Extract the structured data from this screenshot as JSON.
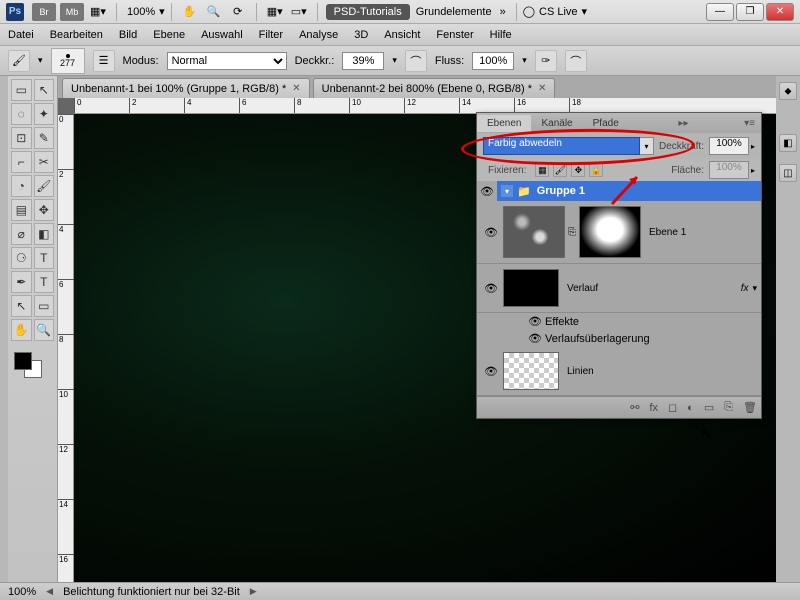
{
  "titlebar": {
    "ps": "Ps",
    "badges": [
      "Br",
      "Mb"
    ],
    "zoom": "100%",
    "tab1": "PSD-Tutorials",
    "tab2": "Grundelemente",
    "cslive": "CS Live"
  },
  "menu": [
    "Datei",
    "Bearbeiten",
    "Bild",
    "Ebene",
    "Auswahl",
    "Filter",
    "Analyse",
    "3D",
    "Ansicht",
    "Fenster",
    "Hilfe"
  ],
  "options": {
    "brush_size": "277",
    "modus_label": "Modus:",
    "modus_value": "Normal",
    "deckkr_label": "Deckkr.:",
    "deckkr_value": "39%",
    "fluss_label": "Fluss:",
    "fluss_value": "100%"
  },
  "doc_tabs": [
    "Unbenannt-1 bei 100% (Gruppe 1, RGB/8) *",
    "Unbenannt-2 bei 800% (Ebene 0, RGB/8) *"
  ],
  "ruler_h": [
    "0",
    "2",
    "4",
    "6",
    "8",
    "10",
    "12",
    "14",
    "16",
    "18"
  ],
  "ruler_v": [
    "0",
    "2",
    "4",
    "6",
    "8",
    "10",
    "12",
    "14",
    "16"
  ],
  "layers_panel": {
    "tabs": [
      "Ebenen",
      "Kanäle",
      "Pfade"
    ],
    "blend_mode": "Farbig abwedeln",
    "opacity_label": "Deckkraft:",
    "opacity_value": "100%",
    "lock_label": "Fixieren:",
    "fill_label": "Fläche:",
    "fill_value": "100%",
    "group_name": "Gruppe 1",
    "layers": [
      {
        "name": "Ebene 1",
        "thumb": "clouds",
        "has_mask": true
      },
      {
        "name": "Verlauf",
        "thumb": "black",
        "fx": true
      },
      {
        "name": "Linien",
        "thumb": "check"
      }
    ],
    "effects_label": "Effekte",
    "effect1": "Verlaufsüberlagerung"
  },
  "statusbar": {
    "zoom": "100%",
    "msg": "Belichtung funktioniert nur bei 32-Bit"
  },
  "icons": {
    "chevrons": "»",
    "magnify": "🔍",
    "circle": "◯",
    "brush": "🖌",
    "tablet": "▭",
    "airbrush": "✑",
    "eye": "👁",
    "folder": "📁",
    "fx": "fx",
    "link": "⚯",
    "mask_ic": "◻",
    "adj": "◐",
    "newgrp": "▭",
    "newlyr": "⎘",
    "trash": "🗑",
    "min": "—",
    "max": "❐",
    "close": "✕",
    "tri_d": "▾",
    "tri_r": "▸",
    "dot": "•",
    "shield": "⬥",
    "text": "T",
    "arrow": "↗"
  },
  "tools": [
    [
      "▭",
      "↖"
    ],
    [
      "◌",
      "✦"
    ],
    [
      "⊡",
      "✎"
    ],
    [
      "⌐",
      "✂"
    ],
    [
      "◔",
      "🖌"
    ],
    [
      "▤",
      "✥"
    ],
    [
      "⌀",
      "◧"
    ],
    [
      "⚆",
      "◍"
    ],
    [
      "✒",
      "T"
    ],
    [
      "↖",
      "▭"
    ],
    [
      "✋",
      "🔍"
    ],
    [
      "⟲",
      "⤢"
    ]
  ]
}
